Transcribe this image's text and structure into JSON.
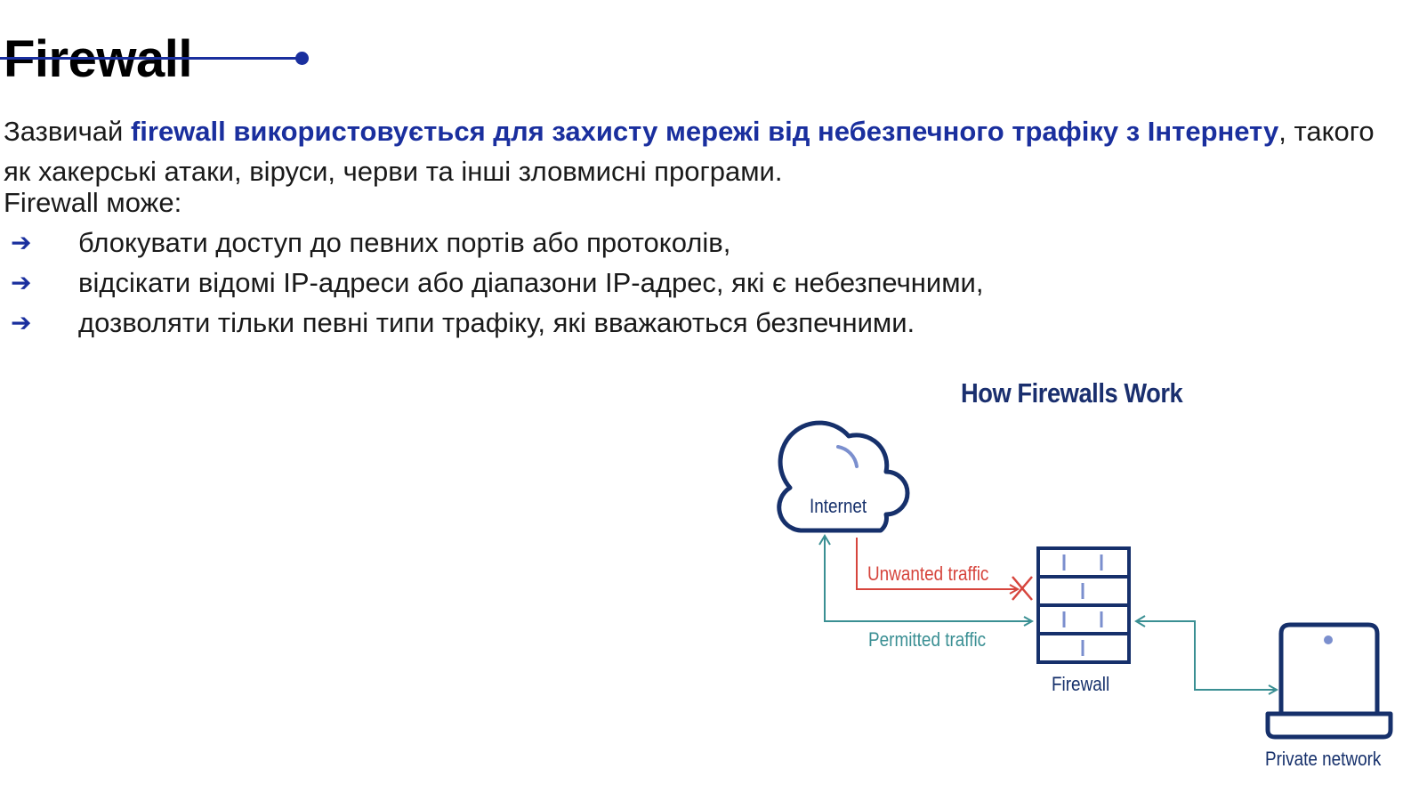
{
  "page": {
    "title": "Firewall"
  },
  "intro": {
    "prefix": "Зазвичай ",
    "highlight": "firewall використовується для захисту мережі від небезпечного трафіку з Інтернету",
    "suffix": ", такого як хакерські атаки, віруси, черви та інші зловмисні програми."
  },
  "capabilities": {
    "lead": "Firewall може:",
    "arrow": "➔",
    "items": [
      "блокувати доступ до певних портів або протоколів,",
      "відсікати відомі IP-адреси або діапазони IP-адрес, які є небезпечними,",
      "дозволяти тільки певні типи трафіку, які вважаються безпечними."
    ]
  },
  "diagram": {
    "title": "How Firewalls Work",
    "internet_label": "Internet",
    "unwanted_label": "Unwanted traffic",
    "permitted_label": "Permitted traffic",
    "firewall_label": "Firewall",
    "private_label": "Private network",
    "icons": [
      "cloud-icon",
      "brick-wall-icon",
      "laptop-icon",
      "blocked-x-icon"
    ],
    "colors": {
      "accent": "#1a2f9e",
      "navy": "#16306b",
      "unwanted": "#d6453d",
      "permitted": "#3a8f93"
    }
  }
}
